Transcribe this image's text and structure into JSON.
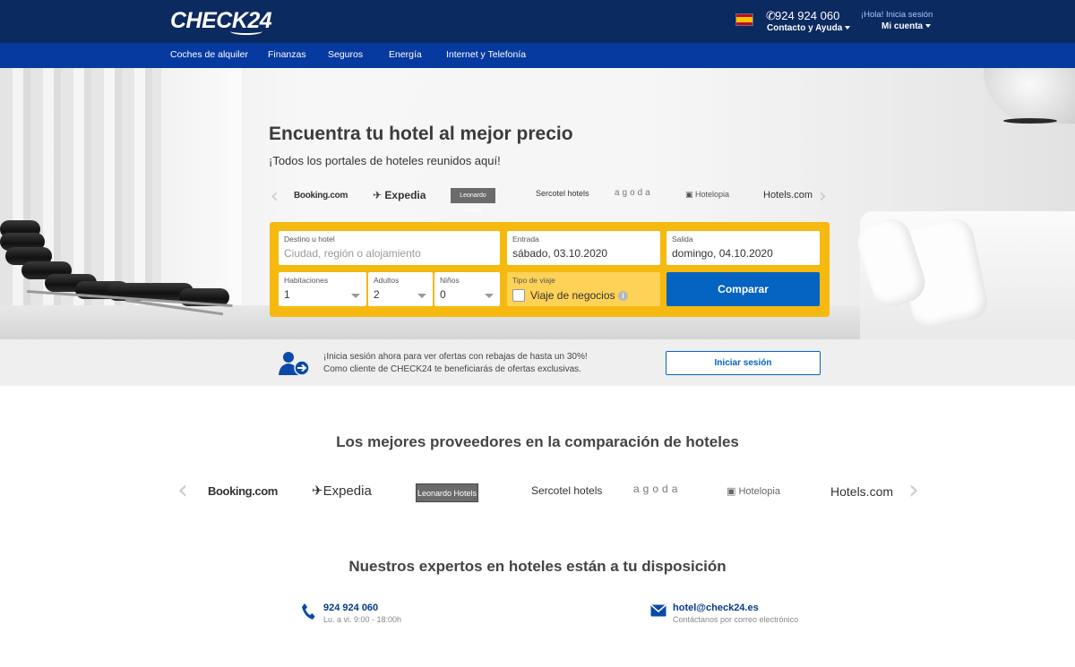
{
  "header": {
    "logo": "CHECK24",
    "phone": "924 924 060",
    "contact_label": "Contacto y Ayuda",
    "greeting": "¡Hola! Inicia sesión",
    "account_label": "Mi cuenta"
  },
  "nav": {
    "items": [
      "Coches de alquiler",
      "Finanzas",
      "Seguros",
      "Energía",
      "Internet y Telefonía"
    ]
  },
  "hero": {
    "title": "Encuentra tu hotel al mejor precio",
    "subtitle": "¡Todos los portales de hoteles reunidos aquí!",
    "brands": [
      "Booking.com",
      "Expedia",
      "Leonardo Hotels",
      "Sercotel hotels",
      "agoda",
      "Hotelopia",
      "Hotels.com"
    ]
  },
  "search": {
    "destination_label": "Destino u hotel",
    "destination_placeholder": "Ciudad, región o alojamiento",
    "checkin_label": "Entrada",
    "checkin_value": "sábado, 03.10.2020",
    "checkout_label": "Salida",
    "checkout_value": "domingo, 04.10.2020",
    "rooms_label": "Habitaciones",
    "rooms_value": "1",
    "adults_label": "Adultos",
    "adults_value": "2",
    "children_label": "Niños",
    "children_value": "0",
    "trip_type_label": "Tipo de viaje",
    "business_trip_label": "Viaje de negocios",
    "info_icon": "i",
    "compare_button": "Comparar"
  },
  "login_promo": {
    "line1": "¡Inicia sesión ahora para ver ofertas con rebajas de hasta un 30%!",
    "line2": "Como cliente de CHECK24 te beneficiarás de ofertas exclusivas.",
    "button": "Iniciar sesión"
  },
  "providers": {
    "title": "Los mejores proveedores en la comparación de hoteles",
    "brands": [
      "Booking.com",
      "Expedia",
      "Leonardo Hotels",
      "Sercotel hotels",
      "agoda",
      "Hotelopia",
      "Hotels.com"
    ]
  },
  "experts": {
    "title": "Nuestros expertos en hoteles están a tu disposición",
    "phone": "924 924 060",
    "phone_hours": "Lu. a vi. 9:00 - 18:00h",
    "email": "hotel@check24.es",
    "email_sub": "Contáctanos por correo electrónico"
  },
  "colors": {
    "header_bg": "#0b2a5f",
    "nav_bg": "#063aa0",
    "panel_yellow": "#f5b90f",
    "primary_blue": "#0563c1"
  }
}
